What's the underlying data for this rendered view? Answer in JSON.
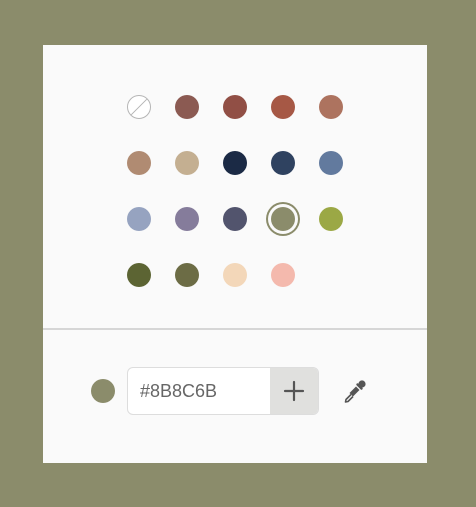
{
  "colors": {
    "backdrop": "#8B8C6B",
    "panel": "#FAFAFA",
    "selected_ring": "#8B8C6B"
  },
  "swatches": [
    {
      "color": "none",
      "name": "no-color-icon"
    },
    {
      "color": "#8B5A52"
    },
    {
      "color": "#914F45"
    },
    {
      "color": "#A65845"
    },
    {
      "color": "#AD735F"
    },
    {
      "color": "#B08B72"
    },
    {
      "color": "#C4AF91"
    },
    {
      "color": "#1B2A45"
    },
    {
      "color": "#2F4260"
    },
    {
      "color": "#627A9E"
    },
    {
      "color": "#96A3C0"
    },
    {
      "color": "#857C9B"
    },
    {
      "color": "#52546D"
    },
    {
      "color": "#8B8C6B",
      "selected": true
    },
    {
      "color": "#9BA845"
    },
    {
      "color": "#5C6433"
    },
    {
      "color": "#6C6C45"
    },
    {
      "color": "#F3D7B9"
    },
    {
      "color": "#F4B9AD"
    }
  ],
  "current": {
    "color": "#8B8C6B",
    "hex_value": "#8B8C6B"
  },
  "icons": {
    "add": "plus-icon",
    "eyedropper": "eyedropper-icon"
  }
}
